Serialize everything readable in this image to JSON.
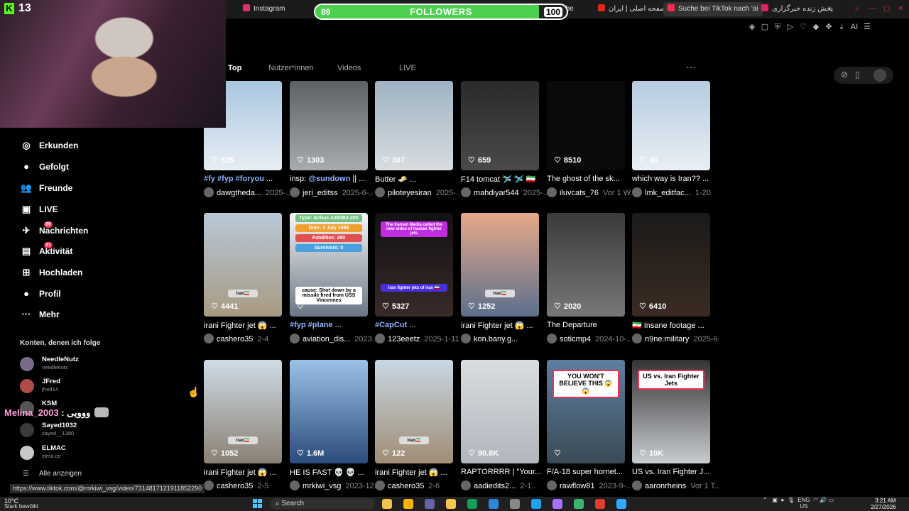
{
  "browser": {
    "tabs": [
      {
        "label": "Instagram",
        "color": "#e1306c"
      },
      {
        "label": "Fun...e Vibe",
        "color": "#666666"
      },
      {
        "label": "صفحه اصلی | ایران",
        "color": "#da291c"
      },
      {
        "label": "Suche bei TikTok nach 'ai",
        "color": "#fe2c55"
      },
      {
        "label": "پخش زنده خبرگزاری",
        "color": "#e0245e"
      }
    ],
    "new_tab_icon": "plus-icon",
    "toolbar_icons": [
      "bookmark-icon",
      "square-icon",
      "shield-icon",
      "play-icon",
      "heart-icon",
      "extension-icon",
      "puzzle-icon",
      "download-icon",
      "ai-icon",
      "menu-icon"
    ],
    "ai_label": "AI"
  },
  "overlay": {
    "kick_logo": "K",
    "kick_viewers": "13",
    "followers": {
      "label": "FOLLOWERS",
      "current": "89",
      "goal": "100",
      "progress": 0.89,
      "bar_color": "#4bd04f"
    },
    "chat": {
      "user": "Melina_2003",
      "separator": " : ",
      "message": "ووو‌‌یی"
    }
  },
  "search": {
    "tabs": [
      {
        "label": "Top",
        "active": true
      },
      {
        "label": "Nutzer*innen",
        "active": false
      },
      {
        "label": "Videos",
        "active": false
      },
      {
        "label": "LIVE",
        "active": false
      }
    ],
    "more": "⋯"
  },
  "sidebar": {
    "nav": [
      {
        "label": "Erkunden",
        "icon": "compass-icon",
        "glyph": "◎"
      },
      {
        "label": "Gefolgt",
        "icon": "avatar-icon",
        "glyph": "●"
      },
      {
        "label": "Freunde",
        "icon": "friends-icon",
        "glyph": "👥"
      },
      {
        "label": "LIVE",
        "icon": "tv-icon",
        "glyph": "▣"
      },
      {
        "label": "Nachrichten",
        "icon": "message-icon",
        "glyph": "✈",
        "badge": "69"
      },
      {
        "label": "Aktivität",
        "icon": "activity-icon",
        "glyph": "▤",
        "badge": "31"
      },
      {
        "label": "Hochladen",
        "icon": "upload-icon",
        "glyph": "⊞"
      },
      {
        "label": "Profil",
        "icon": "profile-icon",
        "glyph": "●"
      },
      {
        "label": "Mehr",
        "icon": "more-icon",
        "glyph": "···"
      }
    ],
    "following_heading": "Konten, denen ich folge",
    "following": [
      {
        "name": "NeedleNutz",
        "handle": "needlenuts"
      },
      {
        "name": "JFred",
        "handle": "jfred14"
      },
      {
        "name": "KSM",
        "handle": ""
      },
      {
        "name": "Sayed1032",
        "handle": "sayed__1380"
      },
      {
        "name": "ELMAC",
        "handle": "elma.ctr"
      }
    ],
    "show_all": "Alle anzeigen"
  },
  "status_url": "https://www.tiktok.com/@mrkiwi_vsg/video/7314817121911852290",
  "videos": [
    {
      "likes": "525",
      "caption_tag": "#fy #fyp #foryou",
      "caption": " ...",
      "user": "dawgtheda...",
      "date": "2025-..",
      "thumb": [
        "#a9c6e0",
        "#e7eef4"
      ]
    },
    {
      "likes": "1303",
      "caption": "insp: ",
      "caption_tag": "@sundown",
      "caption2": " || ...",
      "user": "jeri_editss",
      "date": "2025-6-..",
      "thumb": [
        "#5d6164",
        "#a8acae"
      ]
    },
    {
      "likes": "307",
      "caption": "Butter 🧈 ...",
      "user": "piloteyesiran",
      "date": "2025-..",
      "thumb": [
        "#9fb3c3",
        "#d8dde0"
      ]
    },
    {
      "likes": "659",
      "caption": "F14 tomcat 🛩️ 🛩️ 🇮🇷",
      "user": "mahdiyar544",
      "date": "2025-..",
      "thumb": [
        "#2a2a2a",
        "#4a4a4a"
      ]
    },
    {
      "likes": "8510",
      "caption": "The ghost of the sk...",
      "user": "iluvcats_76",
      "date": "Vor 1 W...",
      "thumb": [
        "#0a0a0a",
        "#0a0a0a"
      ]
    },
    {
      "likes": "46",
      "caption": "which way is Iran?? ...",
      "user": "lmk_editfac...",
      "date": "1-20",
      "thumb": [
        "#b5cbe0",
        "#e9eff4"
      ]
    },
    {
      "likes": "4441",
      "caption_tag": "",
      "caption": "irani Fighter jet 😱 ...",
      "user": "cashero35",
      "date": "2-4",
      "thumb": [
        "#b8c8d8",
        "#a89a82"
      ],
      "badge": "Iran🇮🇷"
    },
    {
      "likes": "",
      "caption_tag": "#fyp #plane",
      "caption": " ...",
      "user": "aviation_dis...",
      "date": "2023..",
      "thumb": [
        "#f6f6f6",
        "#6a7685"
      ],
      "overlays": [
        "Type: Airbus A300B2-203",
        "Date: 3 July 1988",
        "Fatalities: 290",
        "Survivors: 0",
        "cause: Shot down by a missile fired from USS Vincennes"
      ]
    },
    {
      "likes": "5327",
      "caption_tag": "#CapCut",
      "caption": " ...",
      "user": "123eeetz",
      "date": "2025-1-11",
      "thumb": [
        "#111",
        "#3a2a2a"
      ],
      "overlays": [
        "The Iranian Media called the new video of Iranian fighter jets",
        "Iran fighter jets of iran 🇮🇷"
      ]
    },
    {
      "likes": "1252",
      "caption": "irani Fighter jet 😱 ...",
      "user": "kon.bany.g...",
      "date": "",
      "thumb": [
        "#e7a98a",
        "#5c6f8c"
      ],
      "badge": "Iran🇮🇷"
    },
    {
      "likes": "2020",
      "caption": "The Departure",
      "user": "soticmp4",
      "date": "2024-10-..",
      "thumb": [
        "#3a3a3a",
        "#777"
      ]
    },
    {
      "likes": "6410",
      "caption": "🇮🇷 Insane footage ...",
      "user": "n9ne.military",
      "date": "2025-6-15",
      "thumb": [
        "#1b1a19",
        "#3a2b22"
      ]
    },
    {
      "likes": "1052",
      "caption": "irani Fighter jet 😱 ...",
      "user": "cashero35",
      "date": "2-5",
      "thumb": [
        "#cfdbe6",
        "#8a8073"
      ],
      "badge": "Iran🇮🇷"
    },
    {
      "likes": "1.6M",
      "caption": "HE IS FAST 💀 💀 ...",
      "user": "mrkiwi_vsg",
      "date": "2023-12..",
      "thumb": [
        "#9cc2e8",
        "#2b4b7a"
      ]
    },
    {
      "likes": "122",
      "caption": "irani Fighter jet 😱 ...",
      "user": "cashero35",
      "date": "2-6",
      "thumb": [
        "#c8d7e4",
        "#a08d74"
      ],
      "badge": "Iran🇮🇷"
    },
    {
      "likes": "90.8K",
      "caption": "RAPTORRRR | \"Your...",
      "user": "aadiedits2...",
      "date": "2-1..",
      "thumb": [
        "#d9dde1",
        "#b0b6bc"
      ]
    },
    {
      "likes": "",
      "caption": "F/A-18 super hornet...",
      "user": "rawflow81",
      "date": "2023-9-..",
      "thumb": [
        "#5c7fa0",
        "#3b4a55"
      ],
      "overlays": [
        "YOU WON'T BELIEVE THIS 😱😱"
      ]
    },
    {
      "likes": "10K",
      "caption": "US vs. Iran Fighter J...",
      "user": "aaronrheins",
      "date": "Vor 1 T...",
      "thumb": [
        "#333",
        "#c9ccd0"
      ],
      "overlays": [
        "US vs. Iran Fighter Jets"
      ]
    }
  ],
  "taskbar": {
    "temp": "10°C",
    "weather": "Stark bewölkt",
    "search_label": "Search",
    "lang": "ENG",
    "region": "US",
    "time": "3:21 AM",
    "date": "2/27/2026",
    "apps": [
      "#f2c14e",
      "#f7b500",
      "#6264a7",
      "#f2c94c",
      "#0f9d58",
      "#2b88d8",
      "#888888",
      "#1fa1f1",
      "#a970ff",
      "#3cb371",
      "#e03c31",
      "#31a8ff"
    ]
  }
}
